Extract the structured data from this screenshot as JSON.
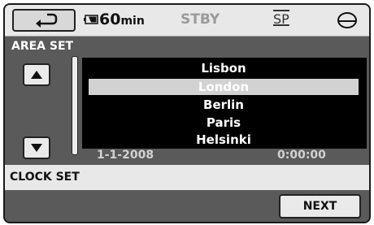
{
  "status": {
    "battery_value": "60",
    "battery_unit": "min",
    "mode": "STBY",
    "quality": "SP"
  },
  "area_set": {
    "title": "AREA SET",
    "cities": [
      "Lisbon",
      "London",
      "Berlin",
      "Paris",
      "Helsinki"
    ],
    "selected_city": "London"
  },
  "datetime": {
    "date": "1-1-2008",
    "time": "0:00:00"
  },
  "clock_set": {
    "title": "CLOCK SET"
  },
  "buttons": {
    "next_label": "NEXT"
  },
  "icons": {
    "back": "return-arrow-icon",
    "battery": "battery-icon",
    "media": "disc-icon",
    "up": "up-arrow-icon",
    "down": "down-arrow-icon"
  },
  "colors": {
    "panel": "#5a5a5a",
    "bars": "#e8e8e8",
    "list_bg": "#000000",
    "selection": "#d2d2d2"
  }
}
